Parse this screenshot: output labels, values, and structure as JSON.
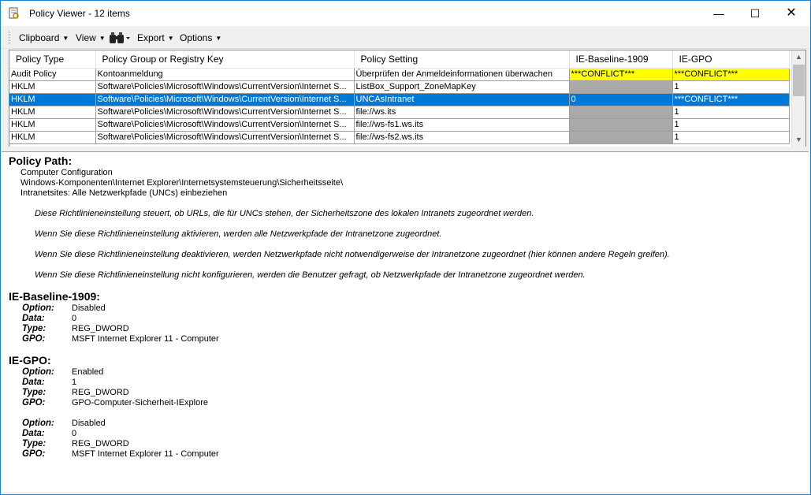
{
  "window": {
    "title": "Policy Viewer - 12 items",
    "min": "—",
    "max": "☐",
    "close": "✕"
  },
  "toolbar": {
    "clipboard": "Clipboard",
    "view": "View",
    "export": "Export",
    "options": "Options",
    "find_icon": "binoculars-icon"
  },
  "grid": {
    "columns": [
      "Policy Type",
      "Policy Group or Registry Key",
      "Policy Setting",
      "IE-Baseline-1909",
      "IE-GPO"
    ],
    "rows": [
      [
        "Audit Policy",
        "Kontoanmeldung",
        "Überprüfen der Anmeldeinformationen überwachen",
        "***CONFLICT***",
        "***CONFLICT***"
      ],
      [
        "HKLM",
        "Software\\Policies\\Microsoft\\Windows\\CurrentVersion\\Internet S...",
        "ListBox_Support_ZoneMapKey",
        "",
        "1"
      ],
      [
        "HKLM",
        "Software\\Policies\\Microsoft\\Windows\\CurrentVersion\\Internet S...",
        "UNCAsIntranet",
        "0",
        "***CONFLICT***"
      ],
      [
        "HKLM",
        "Software\\Policies\\Microsoft\\Windows\\CurrentVersion\\Internet S...",
        "file://ws.its",
        "",
        "1"
      ],
      [
        "HKLM",
        "Software\\Policies\\Microsoft\\Windows\\CurrentVersion\\Internet S...",
        "file://ws-fs1.ws.its",
        "",
        "1"
      ],
      [
        "HKLM",
        "Software\\Policies\\Microsoft\\Windows\\CurrentVersion\\Internet S...",
        "file://ws-fs2.ws.its",
        "",
        "1"
      ]
    ]
  },
  "detail": {
    "policy_path_heading": "Policy Path:",
    "path_lines": [
      "Computer Configuration",
      "Windows-Komponenten\\Internet Explorer\\Internetsystemsteuerung\\Sicherheitsseite\\",
      "Intranetsites: Alle Netzwerkpfade (UNCs) einbeziehen"
    ],
    "descriptions": [
      "Diese Richtlinieneinstellung steuert, ob URLs, die für UNCs stehen, der Sicherheitszone des lokalen Intranets zugeordnet werden.",
      "Wenn Sie diese Richtlinieneinstellung aktivieren, werden alle Netzwerkpfade der Intranetzone zugeordnet.",
      "Wenn Sie diese Richtlinieneinstellung deaktivieren, werden Netzwerkpfade nicht notwendigerweise der Intranetzone zugeordnet (hier können andere Regeln greifen).",
      "Wenn Sie diese Richtlinieneinstellung nicht konfigurieren, werden die Benutzer gefragt, ob Netzwerkpfade der Intranetzone zugeordnet werden."
    ],
    "labels": {
      "option": "Option:",
      "data": "Data:",
      "type": "Type:",
      "gpo": "GPO:"
    },
    "baseline": {
      "heading": "IE-Baseline-1909:",
      "option": "Disabled",
      "data": "0",
      "type": "REG_DWORD",
      "gpo": "MSFT Internet Explorer 11 - Computer"
    },
    "iegpo": {
      "heading": "IE-GPO:",
      "entries": [
        {
          "option": "Enabled",
          "data": "1",
          "type": "REG_DWORD",
          "gpo": "GPO-Computer-Sicherheit-IExplore"
        },
        {
          "option": "Disabled",
          "data": "0",
          "type": "REG_DWORD",
          "gpo": "MSFT Internet Explorer 11 - Computer"
        }
      ]
    }
  }
}
